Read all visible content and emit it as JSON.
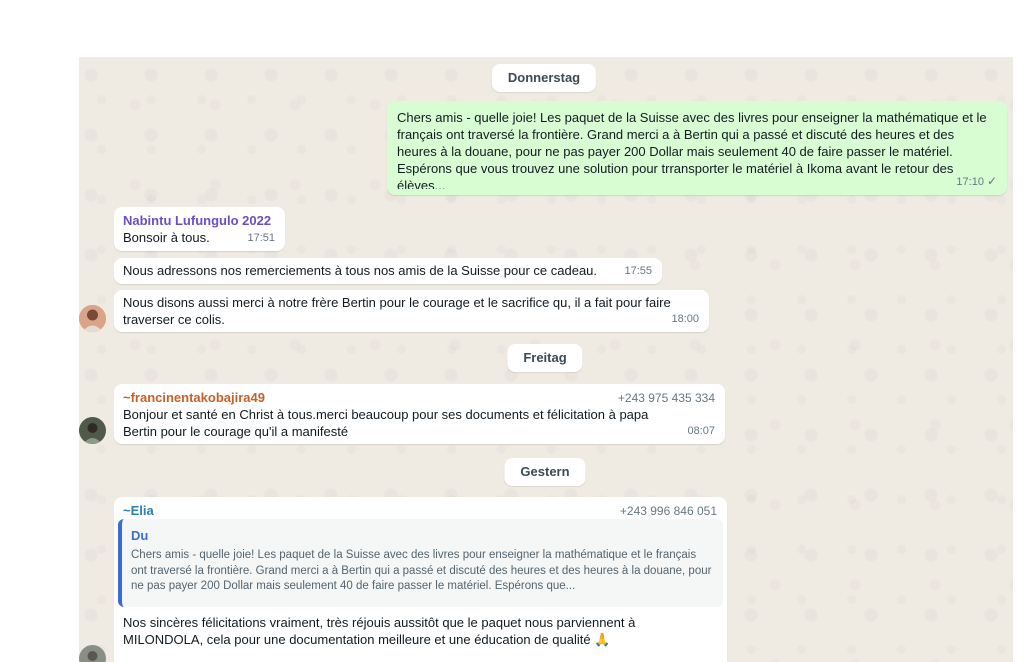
{
  "day_labels": {
    "d1": "Donnerstag",
    "d2": "Freitag",
    "d3": "Gestern"
  },
  "messages": {
    "m1": {
      "text": "Chers amis - quelle joie! Les paquet de la Suisse avec des livres pour enseigner la mathématique et le français ont traversé la frontière. Grand merci a à Bertin qui a passé et discuté des heures et des heures à la douane, pour ne pas payer 200 Dollar mais seulement 40 de faire passer le matériel. Espérons que vous trouvez une solution pour trransporter le matériel à Ikoma avant le retour des élèves...",
      "time": "17:10",
      "status_icon": "check-icon"
    },
    "m2": {
      "sender": "Nabintu  Lufungulo 2022",
      "text": "Bonsoir à tous.",
      "time": "17:51"
    },
    "m3": {
      "text": "Nous adressons nos remerciements à tous nos amis de la Suisse pour ce cadeau.",
      "time": "17:55"
    },
    "m4": {
      "text": "Nous disons aussi merci à notre frère Bertin pour le courage et le sacrifice qu, il a fait pour faire traverser ce colis.",
      "time": "18:00"
    },
    "m5": {
      "sender": "~francinentakobajira49",
      "phone": "+243 975 435 334",
      "text": "Bonjour et santé en Christ à tous.merci beaucoup pour ses documents et félicitation à papa Bertin pour le courage qu'il a manifesté",
      "time": "08:07"
    },
    "m6": {
      "sender": "~Elia",
      "phone": "+243 996 846 051",
      "quote_author": "Du",
      "quote_text": "Chers amis - quelle joie! Les paquet de la Suisse avec des livres pour enseigner la mathématique et le français ont traversé la frontière. Grand merci a à Bertin qui a passé et discuté des heures et des heures à la douane, pour ne pas payer 200 Dollar mais seulement 40 de faire passer le matériel. Espérons que...",
      "text": "Nos sincères félicitations vraiment, très réjouis aussitôt que le paquet nous parviennent à MILONDOLA, cela pour une documentation meilleure et une éducation de qualité 🙏"
    }
  },
  "colors": {
    "chat_background": "#efeae2",
    "outgoing_bubble": "#d9fdd3",
    "incoming_bubble": "#ffffff",
    "sender_nabintu": "#6b4fc2",
    "sender_francine": "#c4612a",
    "sender_elia": "#2a7fb8",
    "quote_accent": "#3b6dd1"
  },
  "icons": {
    "avatar_1": "avatar-nabintu",
    "avatar_2": "avatar-francine",
    "avatar_3": "avatar-elia"
  }
}
